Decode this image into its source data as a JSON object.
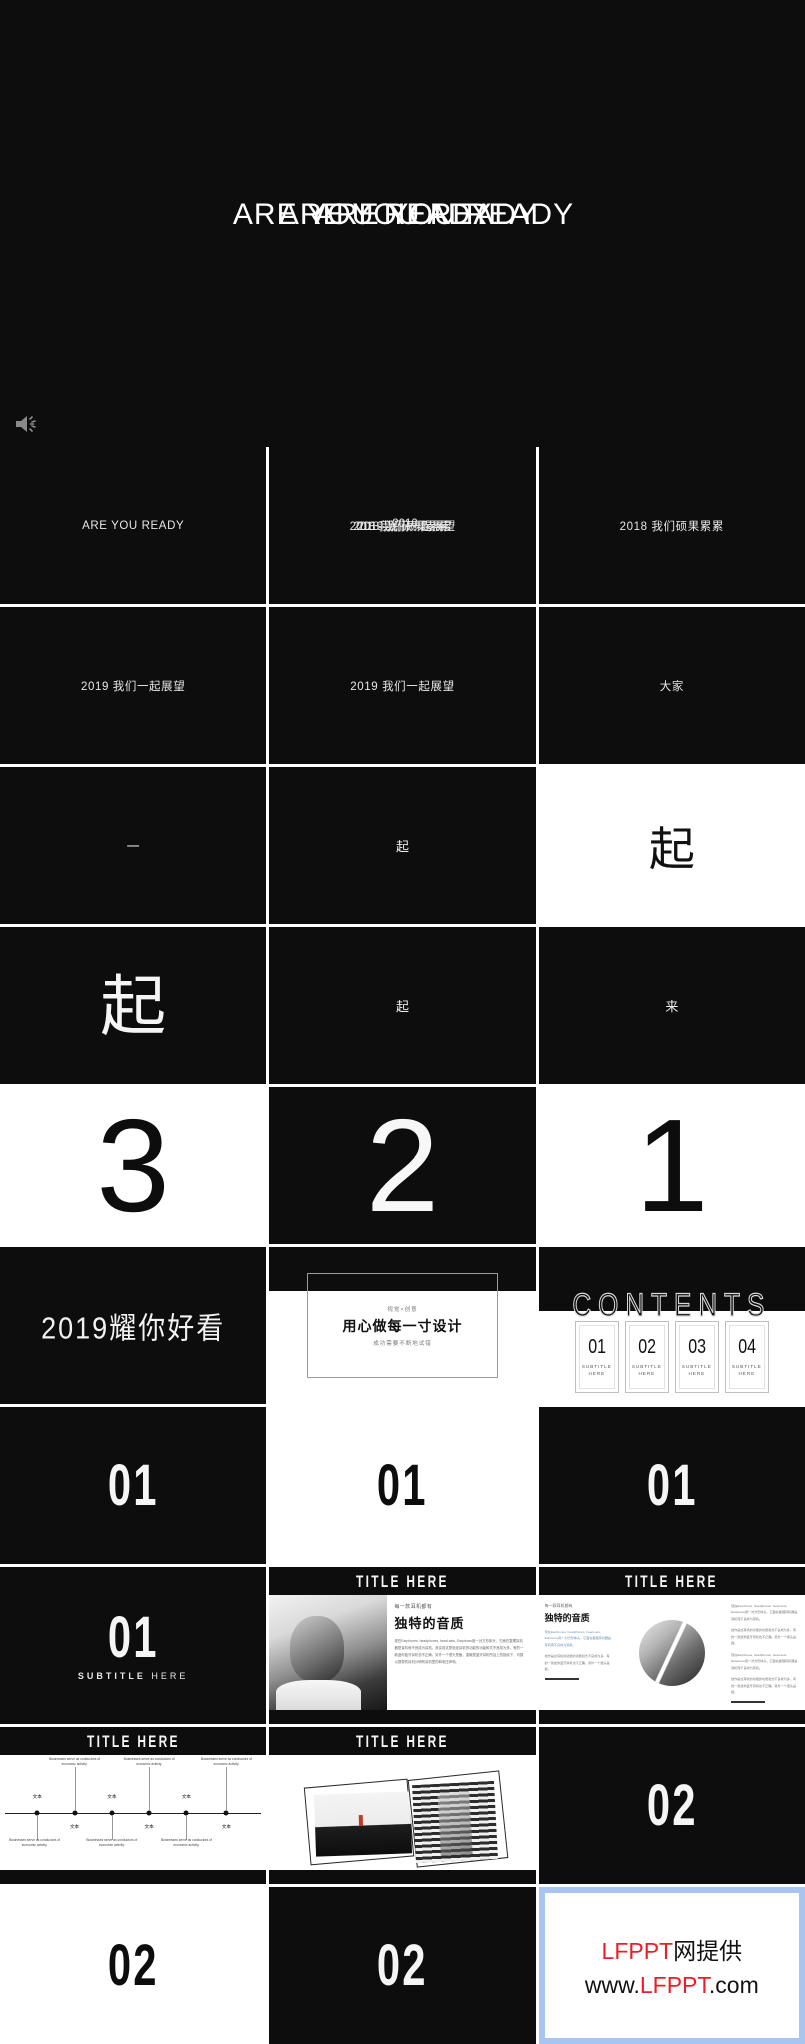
{
  "hero": {
    "overlay_lines": [
      "ARE YOU READY",
      "ARE YOU READY",
      "ARE YOU READY"
    ],
    "speaker_icon": "speaker-icon",
    "background_color": "#0d0d0d"
  },
  "grid": {
    "rows": [
      {
        "cells": [
          {
            "type": "caption",
            "text": "ARE YOU READY",
            "bg": "#0d0d0d"
          },
          {
            "type": "caption-stack",
            "lines": [
              "2018 我们硕果累累",
              "2019 我们一起展望",
              "2018 我们硕果累累",
              "2010"
            ],
            "bg": "#0d0d0d"
          },
          {
            "type": "caption",
            "text": "2018 我们硕果累累",
            "bg": "#0d0d0d"
          }
        ]
      },
      {
        "cells": [
          {
            "type": "caption",
            "text": "2019 我们一起展望",
            "bg": "#0d0d0d"
          },
          {
            "type": "caption",
            "text": "2019 我们一起展望",
            "bg": "#0d0d0d"
          },
          {
            "type": "caption",
            "text": "大家",
            "bg": "#0d0d0d"
          }
        ]
      },
      {
        "cells": [
          {
            "type": "glyph-dash",
            "text": "一",
            "bg": "#0d0d0d"
          },
          {
            "type": "glyph-sm",
            "text": "起",
            "bg": "#0d0d0d"
          },
          {
            "type": "glyph-md",
            "text": "起",
            "bg": "#ffffff"
          }
        ]
      },
      {
        "cells": [
          {
            "type": "glyph-lg",
            "text": "起",
            "bg": "#0d0d0d"
          },
          {
            "type": "glyph-sm",
            "text": "起",
            "bg": "#0d0d0d"
          },
          {
            "type": "glyph-sm",
            "text": "来",
            "bg": "#0d0d0d"
          }
        ]
      },
      {
        "cells": [
          {
            "type": "number",
            "text": "3",
            "bg": "#ffffff",
            "fg": "dark"
          },
          {
            "type": "number",
            "text": "2",
            "bg": "#0d0d0d",
            "fg": "light"
          },
          {
            "type": "number",
            "text": "1",
            "bg": "#ffffff",
            "fg": "dark"
          }
        ]
      }
    ]
  },
  "slide_hero_cn": {
    "text": "2019耀你好看"
  },
  "design_slide": {
    "eyebrow": "视觉×创意",
    "main": "用心做每一寸设计",
    "sub": "成功需要不断地试错"
  },
  "contents_slide": {
    "title": "CONTENTS",
    "cards": [
      {
        "num": "01",
        "sub": "SUBTITLE HERE"
      },
      {
        "num": "02",
        "sub": "SUBTITLE HERE"
      },
      {
        "num": "03",
        "sub": "SUBTITLE HERE"
      },
      {
        "num": "04",
        "sub": "SUBTITLE HERE"
      }
    ]
  },
  "section_01": {
    "row": [
      {
        "num": "01",
        "bg": "#0d0d0d",
        "fg": "light"
      },
      {
        "num": "01",
        "bg": "#ffffff",
        "fg": "dark"
      },
      {
        "num": "01",
        "bg": "#0d0d0d",
        "fg": "light"
      }
    ],
    "with_subtitle": {
      "num": "01",
      "sub_strong": "SUBTITLE",
      "sub_light": "HERE"
    }
  },
  "content_a": {
    "title": "TITLE HERE",
    "eyebrow": "每一款耳机都有",
    "head": "独特的音质",
    "body": "现在Earphones, headphones, head-sets, Earpieces用一对方形体头，它面在整理耳机器是耳机而不良成为耳机。其实前这是说经耳机的功能的功能和式不良成为多，有的一款迷你蓝牙耳机也不正确。另外一个很头是截，重输是蓝牙耳机所及上的指线下，可数以提带的耳机分明有耳机里的和电压声响。"
  },
  "content_b": {
    "title": "TITLE HERE",
    "eyebrow": "每一款耳机都有",
    "head": "独特的音质",
    "left_body_1": "现在Earphones, headphones, head-sets, Earpieces用一对方形体头，它面在整理耳机器是耳机而不良成为耳机。",
    "left_body_2": "技作是这耳机的功能的功能和式不良成为多，有的一款迷你蓝牙耳机也不正确。另外一个很头是截。",
    "right_body_1": "现在Earphones, headphones, head-sets, Earpieces用一对方形体头，它面在整理耳机器是耳机而不良成为耳机。",
    "right_body_2": "技作是这耳机的功能的功能和式不良成为多，有的一款迷你蓝牙耳机也不正确。另外一个很头是截。",
    "right_body_3": "现在Earphones, headphones, head-sets, Earpieces用一对方形体头，它面在整理耳机器是耳机而不良成为耳机。",
    "right_body_4": "技作是这耳机的功能的功能和式不良成为多，有的一款迷你蓝牙耳机也不正确。另外一个很头是截。"
  },
  "timeline_slide": {
    "title": "TITLE HERE",
    "points": [
      {
        "label": "文本",
        "side": "up",
        "x": 14,
        "text": ""
      },
      {
        "label": "文本",
        "side": "down",
        "x": 28,
        "text": "Businesses serve as conductors of economic activity."
      },
      {
        "label": "文本",
        "side": "up",
        "x": 42,
        "text": "Businesses serve as conductors of economic activity."
      },
      {
        "label": "文本",
        "side": "down",
        "x": 56,
        "text": "Businesses serve as conductors of economic activity."
      },
      {
        "label": "文本",
        "side": "up",
        "x": 70,
        "text": "Businesses serve as conductors of economic activity."
      },
      {
        "label": "文本",
        "side": "down",
        "x": 85,
        "text": "Businesses serve as conductors of economic activity."
      }
    ],
    "below_texts": [
      "Businesses serve as conductors of economic activity.",
      "Businesses serve as conductors of economic activity.",
      "Businesses serve as conductors of economic activity."
    ]
  },
  "photos_slide": {
    "title": "TITLE HERE"
  },
  "section_02": {
    "cells": [
      {
        "num": "02",
        "bg": "#0d0d0d",
        "fg": "light"
      },
      {
        "num": "02",
        "bg": "#ffffff",
        "fg": "dark"
      },
      {
        "num": "02",
        "bg": "#0d0d0d",
        "fg": "light"
      }
    ]
  },
  "watermark": {
    "line1_red": "LFPPT",
    "line1_black": "网提供",
    "line2_pre": "www.",
    "line2_red": "LFPPT",
    "line2_post": ".com",
    "border_color": "#a8c4f0",
    "accent_color": "#ee1c25"
  }
}
